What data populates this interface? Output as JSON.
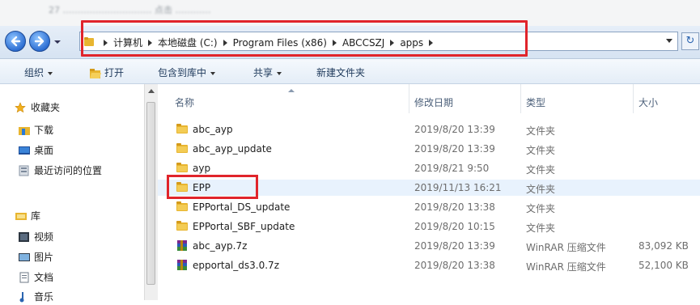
{
  "top_strip_text": "27 ………………………… 点击 …………",
  "address": {
    "crumbs": [
      "计算机",
      "本地磁盘 (C:)",
      "Program Files (x86)",
      "ABCCSZJ",
      "apps"
    ],
    "refresh_glyph": "↻"
  },
  "toolbar": {
    "organize": "组织",
    "open": "打开",
    "include": "包含到库中",
    "share": "共享",
    "new_folder": "新建文件夹"
  },
  "sidebar": {
    "favorites": "收藏夹",
    "downloads": "下载",
    "desktop": "桌面",
    "recent": "最近访问的位置",
    "libraries": "库",
    "videos": "视频",
    "pictures": "图片",
    "documents": "文档",
    "music": "音乐"
  },
  "columns": {
    "name": "名称",
    "modified": "修改日期",
    "type": "类型",
    "size": "大小"
  },
  "files": [
    {
      "name": "abc_ayp",
      "date": "2019/8/20 13:39",
      "type": "文件夹",
      "size": "",
      "kind": "folder"
    },
    {
      "name": "abc_ayp_update",
      "date": "2019/8/20 13:39",
      "type": "文件夹",
      "size": "",
      "kind": "folder"
    },
    {
      "name": "ayp",
      "date": "2019/8/21 9:50",
      "type": "文件夹",
      "size": "",
      "kind": "folder"
    },
    {
      "name": "EPP",
      "date": "2019/11/13 16:21",
      "type": "文件夹",
      "size": "",
      "kind": "folder"
    },
    {
      "name": "EPPortal_DS_update",
      "date": "2019/8/20 13:38",
      "type": "文件夹",
      "size": "",
      "kind": "folder"
    },
    {
      "name": "EPPortal_SBF_update",
      "date": "2019/8/20 10:15",
      "type": "文件夹",
      "size": "",
      "kind": "folder"
    },
    {
      "name": "abc_ayp.7z",
      "date": "2019/8/20 13:39",
      "type": "WinRAR 压缩文件",
      "size": "83,092 KB",
      "kind": "archive"
    },
    {
      "name": "epportal_ds3.0.7z",
      "date": "2019/8/20 13:38",
      "type": "WinRAR 压缩文件",
      "size": "52,100 KB",
      "kind": "archive"
    }
  ],
  "colors": {
    "highlight_red": "#e0242b",
    "folder_yellow": "#e8b530",
    "selected_row": "#e8f2fd"
  }
}
